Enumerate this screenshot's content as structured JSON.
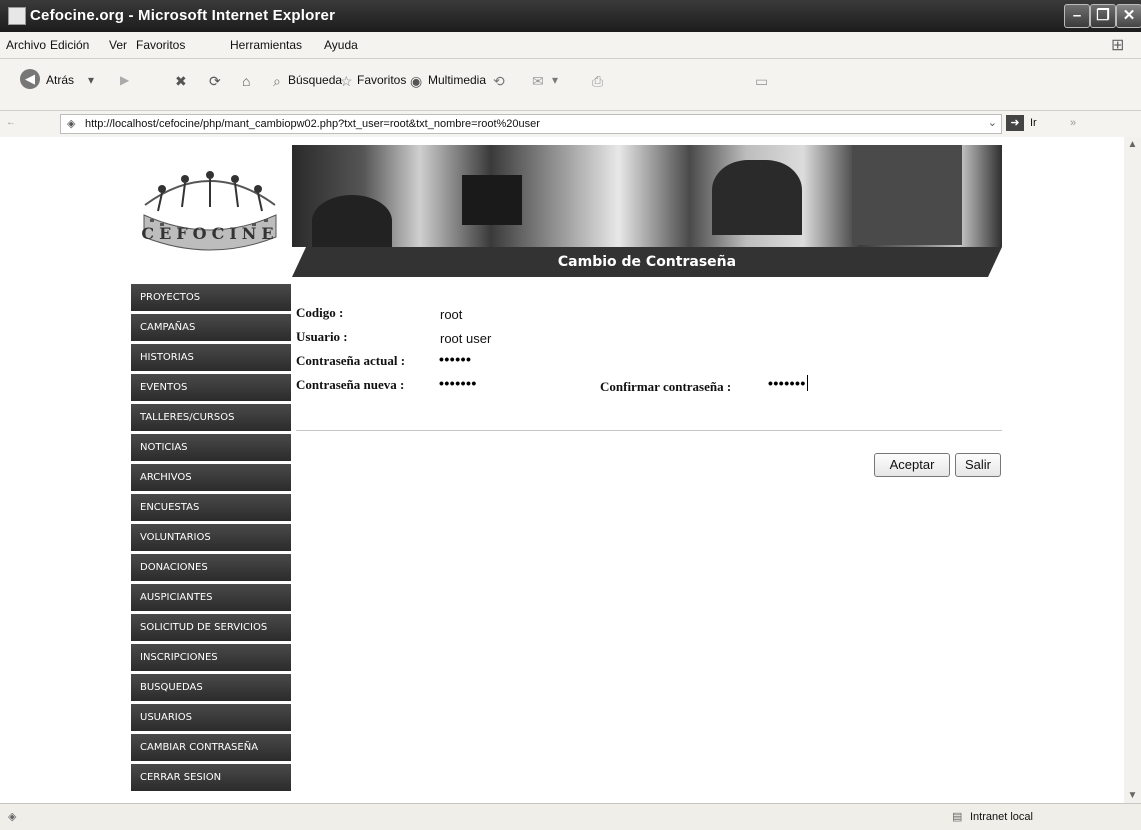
{
  "window": {
    "title": "Cefocine.org - Microsoft Internet Explorer"
  },
  "menubar": {
    "items": [
      "Archivo",
      "Edición",
      "Ver",
      "Favoritos",
      "Herramientas",
      "Ayuda"
    ]
  },
  "toolbar": {
    "back": "Atrás",
    "search": "Búsqueda",
    "favorites": "Favoritos",
    "multimedia": "Multimedia"
  },
  "address": {
    "url": "http://localhost/cefocine/php/mant_cambiopw02.php?txt_user=root&txt_nombre=root%20user",
    "go": "Ir"
  },
  "page": {
    "logo_text": "CEFOCINE",
    "section_title": "Cambio de Contraseña",
    "nav": [
      "PROYECTOS",
      "CAMPAÑAS",
      "HISTORIAS",
      "EVENTOS",
      "TALLERES/CURSOS",
      "NOTICIAS",
      "ARCHIVOS",
      "ENCUESTAS",
      "VOLUNTARIOS",
      "DONACIONES",
      "AUSPICIANTES",
      "SOLICITUD DE SERVICIOS",
      "INSCRIPCIONES",
      "BUSQUEDAS",
      "USUARIOS",
      "CAMBIAR CONTRASEÑA",
      "CERRAR SESION"
    ],
    "form": {
      "codigo_label": "Codigo :",
      "codigo_value": "root",
      "usuario_label": "Usuario :",
      "usuario_value": "root user",
      "actual_label": "Contraseña actual :",
      "actual_value": "••••••",
      "nueva_label": "Contraseña nueva :",
      "nueva_value": "•••••••",
      "confirmar_label": "Confirmar contraseña :",
      "confirmar_value": "•••••••"
    },
    "buttons": {
      "accept": "Aceptar",
      "exit": "Salir"
    }
  },
  "status": {
    "zone": "Intranet local"
  }
}
